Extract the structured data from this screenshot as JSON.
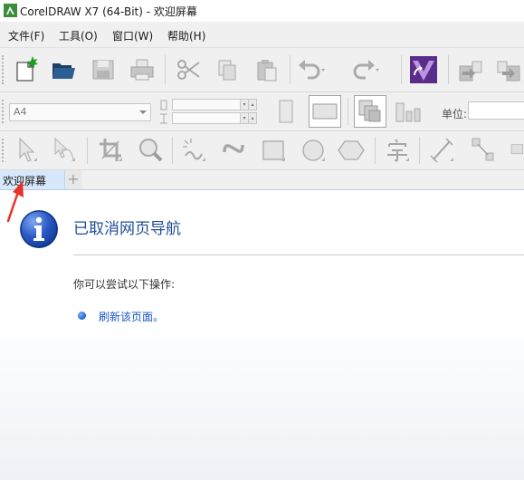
{
  "window": {
    "title": "CorelDRAW X7 (64-Bit) - 欢迎屏幕"
  },
  "menubar": {
    "items": [
      "文件(F)",
      "工具(O)",
      "窗口(W)",
      "帮助(H)"
    ]
  },
  "property_bar": {
    "page_size": "A4",
    "unit_label": "单位:"
  },
  "tabs": {
    "active_label": "欢迎屏幕",
    "add_label": "+"
  },
  "content": {
    "heading": "已取消网页导航",
    "subtext": "你可以尝试以下操作:",
    "link": "刷新该页面。"
  },
  "colors": {
    "heading": "#1f4e96",
    "link": "#1a56c8",
    "tab_active": "#d6e8f9",
    "annotation_arrow": "#e8322a"
  }
}
